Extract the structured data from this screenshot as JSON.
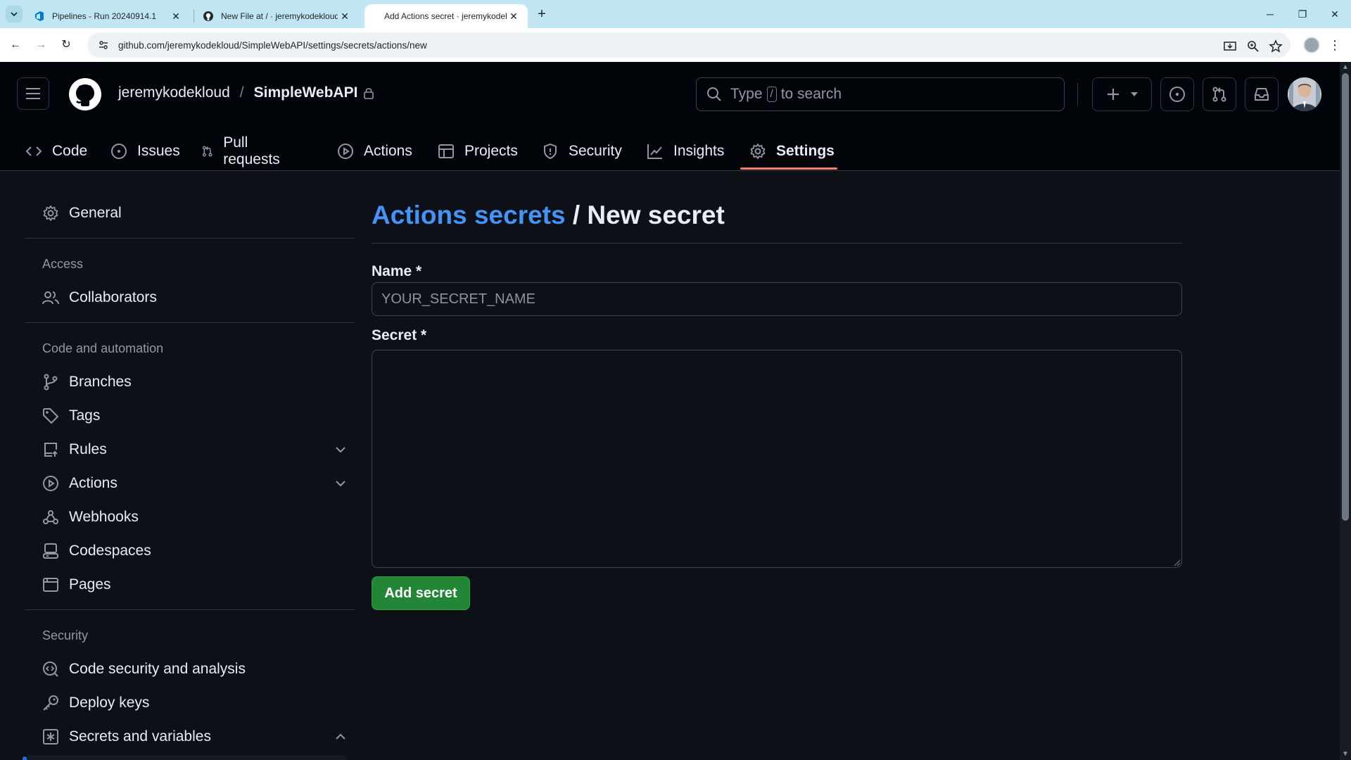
{
  "browser": {
    "tabs": [
      {
        "title": "Pipelines - Run 20240914.1",
        "icon": "azure-devops-icon",
        "active": false
      },
      {
        "title": "New File at / · jeremykodekloud",
        "icon": "github-icon",
        "active": false
      },
      {
        "title": "Add Actions secret · jeremykodekloud",
        "icon": "none",
        "active": true
      }
    ],
    "url": "github.com/jeremykodekloud/SimpleWebAPI/settings/secrets/actions/new"
  },
  "header": {
    "owner": "jeremykodekloud",
    "separator": "/",
    "repo": "SimpleWebAPI",
    "search_prefix": "Type",
    "search_key": "/",
    "search_suffix": "to search"
  },
  "repo_nav": [
    {
      "label": "Code",
      "icon": "code-icon"
    },
    {
      "label": "Issues",
      "icon": "issue-icon"
    },
    {
      "label": "Pull requests",
      "icon": "pull-request-icon"
    },
    {
      "label": "Actions",
      "icon": "play-icon"
    },
    {
      "label": "Projects",
      "icon": "table-icon"
    },
    {
      "label": "Security",
      "icon": "shield-icon"
    },
    {
      "label": "Insights",
      "icon": "graph-icon"
    },
    {
      "label": "Settings",
      "icon": "gear-icon",
      "selected": true
    }
  ],
  "sidebar": {
    "general": "General",
    "access_heading": "Access",
    "collaborators": "Collaborators",
    "code_heading": "Code and automation",
    "branches": "Branches",
    "tags": "Tags",
    "rules": "Rules",
    "actions": "Actions",
    "webhooks": "Webhooks",
    "codespaces": "Codespaces",
    "pages": "Pages",
    "security_heading": "Security",
    "code_security": "Code security and analysis",
    "deploy_keys": "Deploy keys",
    "secrets": "Secrets and variables"
  },
  "main": {
    "breadcrumb_link": "Actions secrets",
    "breadcrumb_sep": "/",
    "title": "New secret",
    "name_label": "Name *",
    "name_placeholder": "YOUR_SECRET_NAME",
    "secret_label": "Secret *",
    "submit_label": "Add secret"
  },
  "colors": {
    "accent_link": "#4493f8",
    "primary_button": "#238636",
    "selected_underline": "#f78166",
    "background": "#0d1117"
  }
}
